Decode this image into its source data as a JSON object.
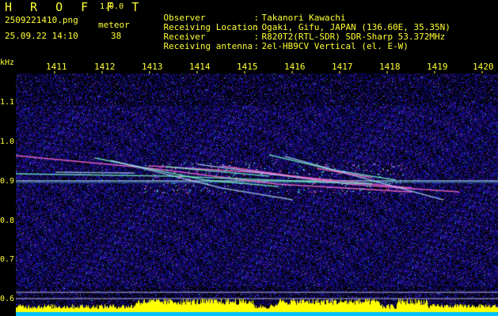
{
  "header": {
    "logo": "H R O F F T",
    "version": "1.0.0",
    "filename": "2509221410.png",
    "datetime": "25.09.22 14:10",
    "meteor_label": "meteor",
    "meteor_count": "38"
  },
  "info": [
    {
      "key": "Observer",
      "value": "Takanori Kawachi"
    },
    {
      "key": "Receiving Location",
      "value": "Ogaki, Gifu, JAPAN (136.60E, 35.35N)"
    },
    {
      "key": "Receiver",
      "value": "R820T2(RTL-SDR) SDR-Sharp 53.372MHz"
    },
    {
      "key": "Receiving antenna",
      "value": "2el-HB9CV Vertical (el. E-W)"
    }
  ],
  "x_axis": {
    "ticks": [
      "1411",
      "1412",
      "1413",
      "1414",
      "1415",
      "1416",
      "1417",
      "1418",
      "1419",
      "1420"
    ]
  },
  "y_axis": {
    "unit": "kHz",
    "ticks": [
      "1.1",
      "1.0",
      "0.9",
      "0.8",
      "0.7",
      "0.6"
    ]
  },
  "colors": {
    "text": "#ffff33",
    "background": "#000000",
    "noise": "#1a1a90",
    "carrier": "#c8ffff",
    "meteor": "#ff66cc",
    "bottom_bar": "#ffff00",
    "bottom_base": "#00c0ff"
  }
}
